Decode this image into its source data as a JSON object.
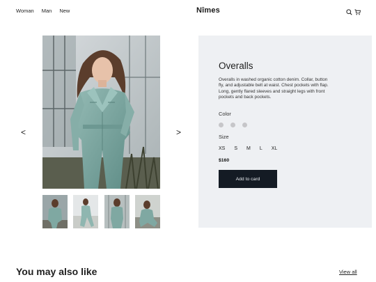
{
  "nav": {
    "links": [
      {
        "label": "Woman"
      },
      {
        "label": "Man"
      },
      {
        "label": "New"
      }
    ]
  },
  "header": {
    "logo": "Nîmes",
    "icons": [
      "search-icon",
      "cart-icon"
    ]
  },
  "gallery": {
    "prev_label": "<",
    "next_label": ">",
    "thumbnail_count": 4
  },
  "product": {
    "title": "Overalls",
    "description": "Overalls in washed organic cotton denim. Collar, button fly, and adjustable belt at waist. Chest pockets with flap. Long, gently flared sleeves and straight legs with front pockets and back pockets.",
    "color_label": "Color",
    "colors": [
      "#c6c6c9",
      "#c6c6c9",
      "#c6c6c9"
    ],
    "size_label": "Size",
    "sizes": [
      "XS",
      "S",
      "M",
      "L",
      "XL"
    ],
    "price": "$160",
    "add_button_label": "Add to card"
  },
  "recommendations": {
    "heading": "You may also like",
    "view_all_label": "View all"
  },
  "colors": {
    "panel_bg": "#eef0f3",
    "button_bg": "#141b24",
    "denim": "#7fa8a2"
  }
}
